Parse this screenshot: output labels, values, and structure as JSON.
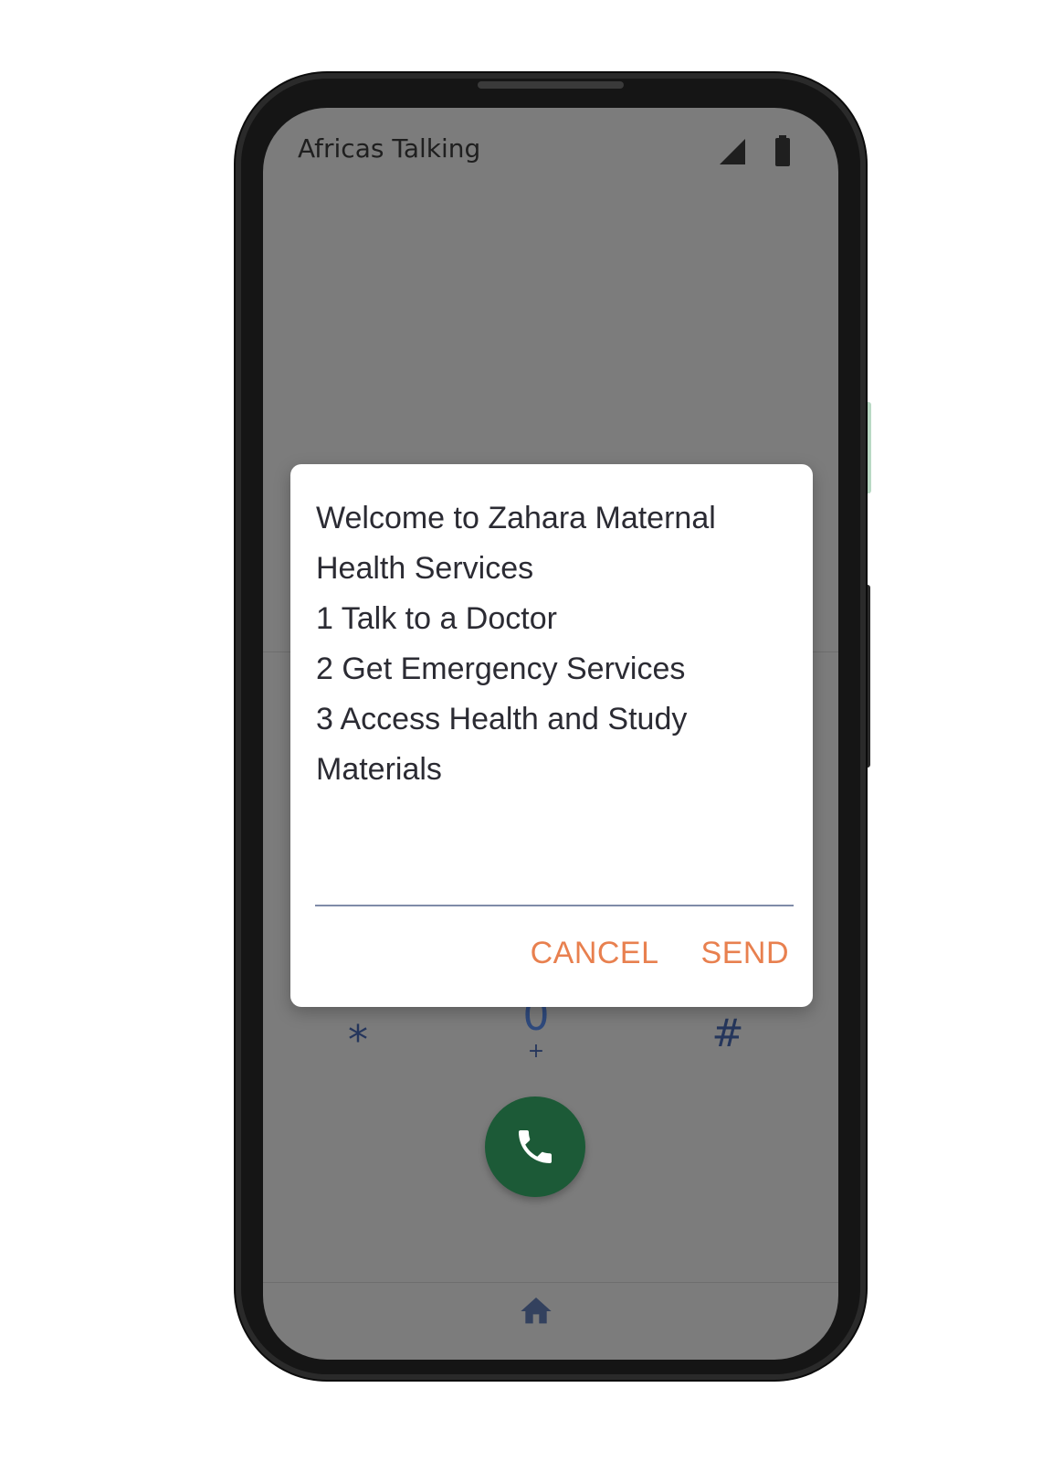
{
  "status_bar": {
    "carrier": "Africas Talking",
    "signal_icon": "signal-icon",
    "battery_icon": "battery-icon"
  },
  "dialog": {
    "message_lines": [
      "Welcome to Zahara Maternal",
      "Health Services",
      "1 Talk to a Doctor",
      "2 Get Emergency Services",
      "3 Access Health and Study",
      "Materials"
    ],
    "input_value": "",
    "input_placeholder": "",
    "cancel_label": "CANCEL",
    "send_label": "SEND",
    "action_color": "#e8804f"
  },
  "keypad": {
    "star": "*",
    "zero": "0",
    "plus": "+",
    "hash": "#"
  },
  "call_button": {
    "icon": "phone-icon",
    "color": "#1c5a37"
  },
  "nav": {
    "home_icon": "home-icon"
  }
}
